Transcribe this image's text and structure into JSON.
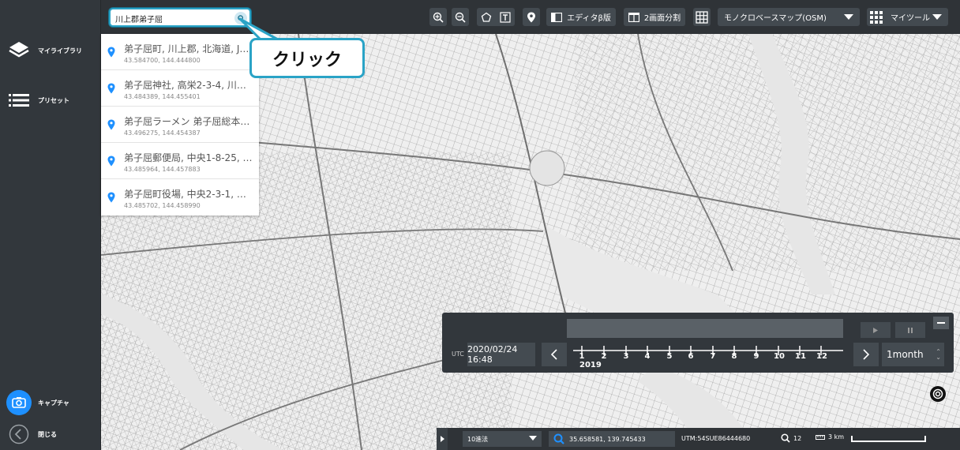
{
  "sidebar": {
    "library_label": "マイライブラリ",
    "preset_label": "プリセット",
    "capture_label": "キャプチャ",
    "close_label": "閉じる"
  },
  "search": {
    "value": "川上郡弟子屈"
  },
  "toolbar": {
    "editor_label": "エディタβ版",
    "split_label": "2画面分割",
    "basemap_label": "モノクロベースマップ(OSM)",
    "mytools_label": "マイツール"
  },
  "results": [
    {
      "name": "弟子屈町, 川上郡, 北海道, J…",
      "coord": "43.584700, 144.444800"
    },
    {
      "name": "弟子屈神社, 高栄2-3-4, 川…",
      "coord": "43.484389, 144.455401"
    },
    {
      "name": "弟子屈ラーメン 弟子屈総本…",
      "coord": "43.496275, 144.454387"
    },
    {
      "name": "弟子屈郵便局, 中央1-8-25, …",
      "coord": "43.485964, 144.457883"
    },
    {
      "name": "弟子屈町役場, 中央2-3-1, …",
      "coord": "43.485702, 144.458990"
    }
  ],
  "callout": {
    "text": "クリック"
  },
  "timeline": {
    "utc_label": "UTC",
    "datetime": "2020/02/24 16:48",
    "year": "2019",
    "months": [
      "1",
      "2",
      "3",
      "4",
      "5",
      "6",
      "7",
      "8",
      "9",
      "10",
      "11",
      "12"
    ],
    "period": "1month"
  },
  "status": {
    "coord_system": "10進法",
    "coordinates": "35.658581, 139.745433",
    "utm": "UTM:54SUE86444680",
    "zoom": "12",
    "scale": "3 km"
  },
  "colors": {
    "accent": "#2aa3c6",
    "pin": "#1e90ff",
    "panel": "#32373c"
  }
}
